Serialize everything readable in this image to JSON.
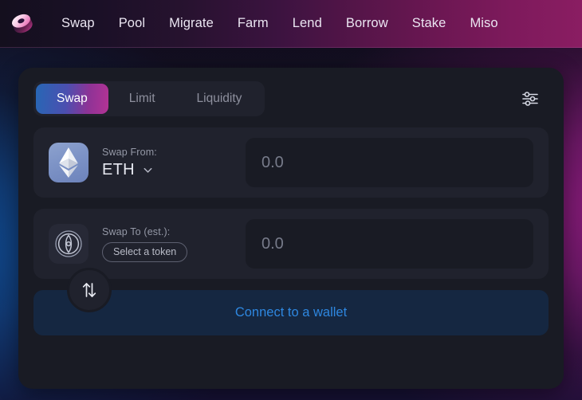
{
  "header": {
    "logo_icon": "sushi-token-logo-icon",
    "nav": [
      {
        "label": "Swap"
      },
      {
        "label": "Pool"
      },
      {
        "label": "Migrate"
      },
      {
        "label": "Farm"
      },
      {
        "label": "Lend"
      },
      {
        "label": "Borrow"
      },
      {
        "label": "Stake"
      },
      {
        "label": "Miso"
      }
    ]
  },
  "card": {
    "tabs": [
      {
        "label": "Swap",
        "active": true
      },
      {
        "label": "Limit",
        "active": false
      },
      {
        "label": "Liquidity",
        "active": false
      }
    ],
    "settings_icon": "sliders-settings-icon",
    "swap_from": {
      "label": "Swap From:",
      "token_symbol": "ETH",
      "token_icon": "ethereum-icon",
      "chevron_icon": "chevron-down-icon",
      "amount_value": "",
      "amount_placeholder": "0.0"
    },
    "swap_direction_icon": "swap-vertical-arrows-icon",
    "swap_to": {
      "label": "Swap To (est.):",
      "select_token_label": "Select a token",
      "token_icon": "unknown-token-icon",
      "amount_value": "",
      "amount_placeholder": "0.0"
    },
    "connect_wallet_label": "Connect to a wallet"
  },
  "colors": {
    "accent_blue": "#2e87e0",
    "tab_gradient_start": "#2767b5",
    "tab_gradient_end": "#b43395",
    "card_background": "#191b24",
    "panel_background": "#20222d",
    "header_gradient_end": "#8a1d62"
  }
}
